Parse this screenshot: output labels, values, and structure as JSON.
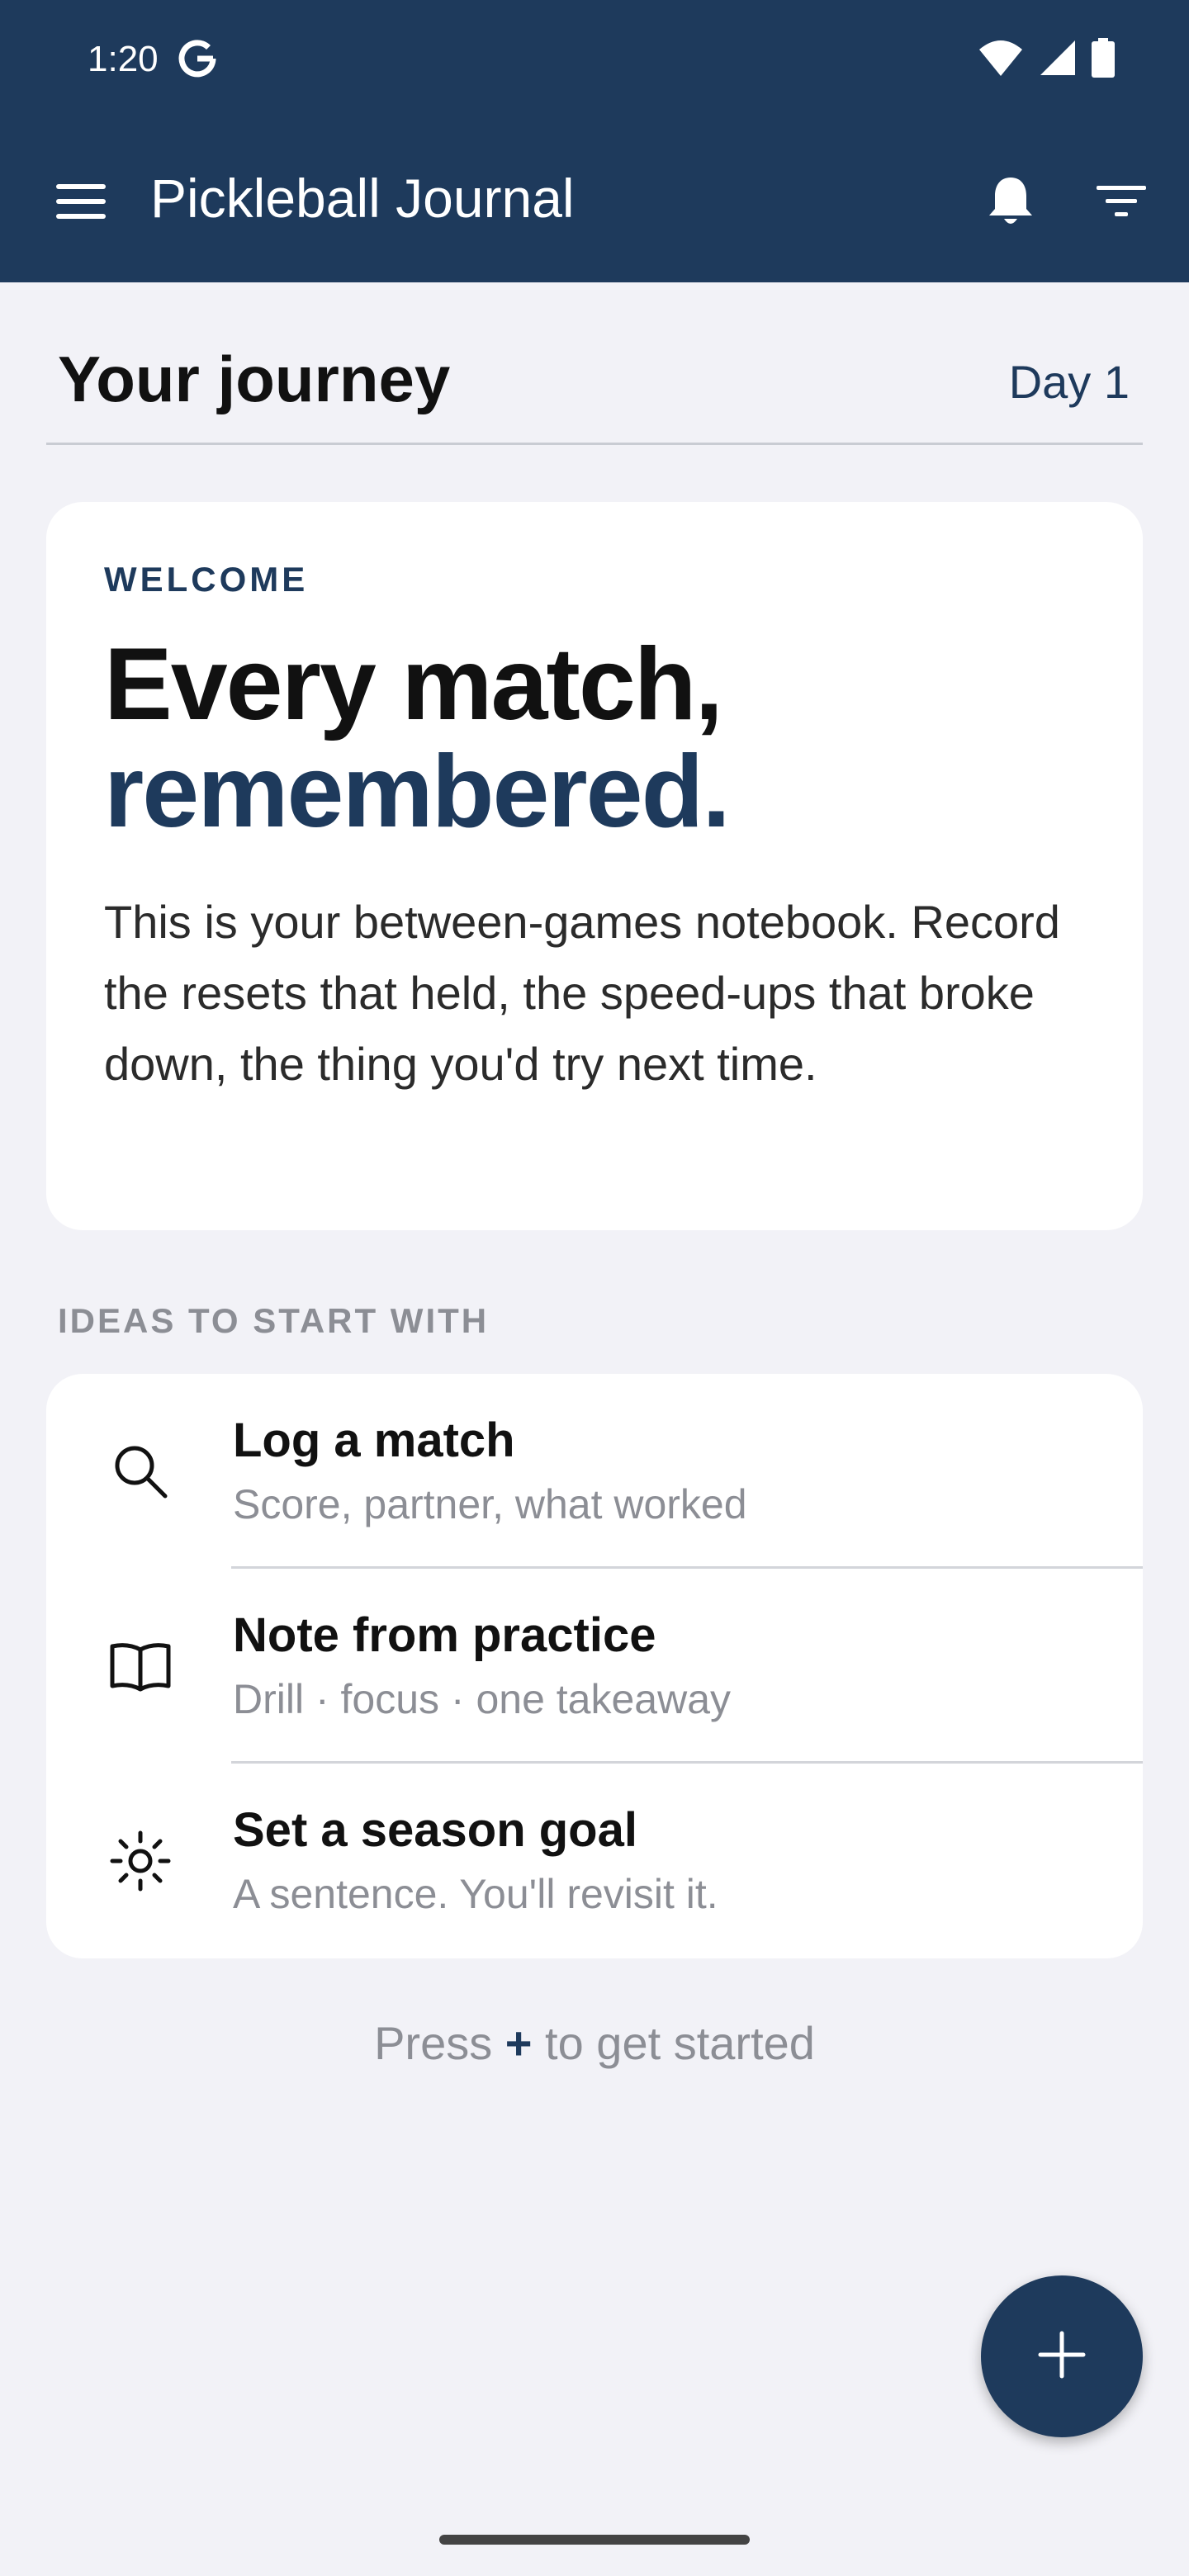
{
  "status_bar": {
    "time": "1:20",
    "g_icon": "google-g-icon",
    "icons": [
      "wifi-icon",
      "signal-icon",
      "battery-icon"
    ]
  },
  "toolbar": {
    "title": "Pickleball Journal",
    "icons": [
      "menu-icon",
      "bell-icon",
      "filter-icon"
    ]
  },
  "journey": {
    "title": "Your journey",
    "day": "Day 1"
  },
  "welcome": {
    "kicker": "WELCOME",
    "headline_line1": "Every match,",
    "headline_line2": "remembered.",
    "body": "This is your between-games notebook. Record the resets that held, the speed-ups that broke down, the thing you'd try next time."
  },
  "ideas": {
    "label": "IDEAS TO START WITH",
    "items": [
      {
        "icon": "search-icon",
        "title": "Log a match",
        "subtitle": "Score, partner, what worked"
      },
      {
        "icon": "book-icon",
        "title": "Note from practice",
        "subtitle": "Drill · focus · one takeaway"
      },
      {
        "icon": "sun-icon",
        "title": "Set a season goal",
        "subtitle": "A sentence. You'll revisit it."
      }
    ]
  },
  "hint": {
    "before": "Press",
    "plus": "+",
    "after": "to get started"
  },
  "fab": {
    "icon": "plus-icon"
  },
  "colors": {
    "primary": "#1e3a5c",
    "background": "#f2f2f7",
    "card": "#ffffff",
    "muted_text": "#8c8e95"
  }
}
